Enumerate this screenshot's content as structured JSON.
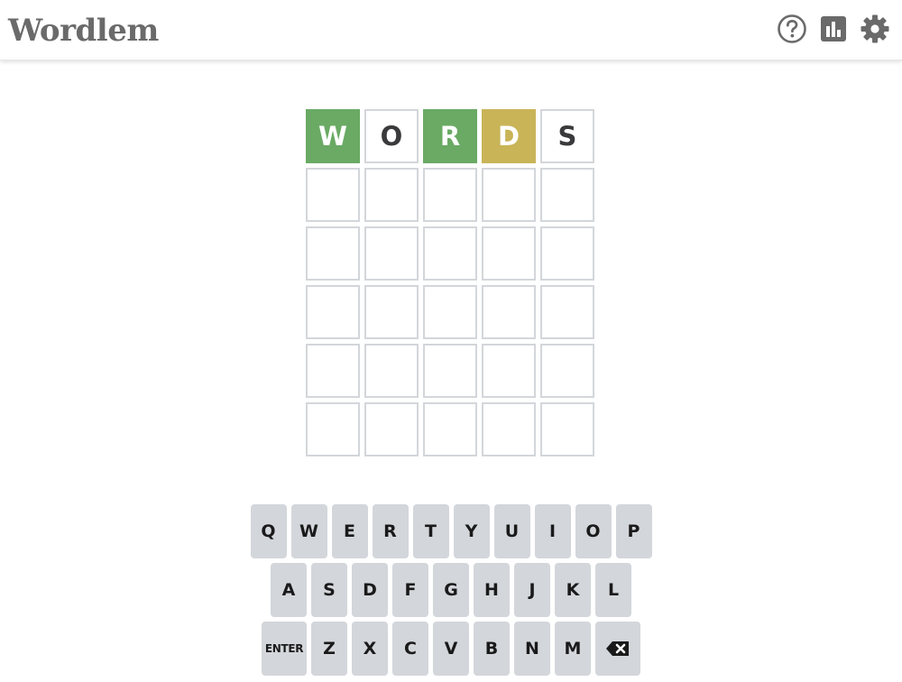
{
  "header": {
    "title": "Wordlem",
    "icons": [
      "help-icon",
      "stats-icon",
      "settings-icon"
    ]
  },
  "colors": {
    "correct": "#6aaa64",
    "present": "#c9b458",
    "empty_border": "#d3d6da",
    "key_bg": "#d3d6da",
    "logo": "#6a6a6a"
  },
  "board": {
    "rows": [
      [
        {
          "letter": "W",
          "state": "correct"
        },
        {
          "letter": "O",
          "state": "filled"
        },
        {
          "letter": "R",
          "state": "correct"
        },
        {
          "letter": "D",
          "state": "present"
        },
        {
          "letter": "S",
          "state": "filled"
        }
      ],
      [
        {
          "letter": "",
          "state": "empty"
        },
        {
          "letter": "",
          "state": "empty"
        },
        {
          "letter": "",
          "state": "empty"
        },
        {
          "letter": "",
          "state": "empty"
        },
        {
          "letter": "",
          "state": "empty"
        }
      ],
      [
        {
          "letter": "",
          "state": "empty"
        },
        {
          "letter": "",
          "state": "empty"
        },
        {
          "letter": "",
          "state": "empty"
        },
        {
          "letter": "",
          "state": "empty"
        },
        {
          "letter": "",
          "state": "empty"
        }
      ],
      [
        {
          "letter": "",
          "state": "empty"
        },
        {
          "letter": "",
          "state": "empty"
        },
        {
          "letter": "",
          "state": "empty"
        },
        {
          "letter": "",
          "state": "empty"
        },
        {
          "letter": "",
          "state": "empty"
        }
      ],
      [
        {
          "letter": "",
          "state": "empty"
        },
        {
          "letter": "",
          "state": "empty"
        },
        {
          "letter": "",
          "state": "empty"
        },
        {
          "letter": "",
          "state": "empty"
        },
        {
          "letter": "",
          "state": "empty"
        }
      ],
      [
        {
          "letter": "",
          "state": "empty"
        },
        {
          "letter": "",
          "state": "empty"
        },
        {
          "letter": "",
          "state": "empty"
        },
        {
          "letter": "",
          "state": "empty"
        },
        {
          "letter": "",
          "state": "empty"
        }
      ]
    ]
  },
  "keyboard": {
    "rows": [
      [
        "Q",
        "W",
        "E",
        "R",
        "T",
        "Y",
        "U",
        "I",
        "O",
        "P"
      ],
      [
        "A",
        "S",
        "D",
        "F",
        "G",
        "H",
        "J",
        "K",
        "L"
      ],
      [
        "ENTER",
        "Z",
        "X",
        "C",
        "V",
        "B",
        "N",
        "M",
        "backspace-icon"
      ]
    ]
  }
}
